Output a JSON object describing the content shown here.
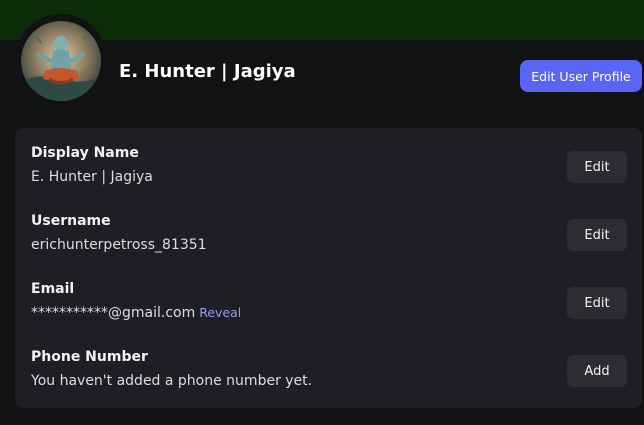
{
  "profile": {
    "display_title": "E. Hunter | Jagiya",
    "edit_profile_label": "Edit User Profile"
  },
  "colors": {
    "banner": "#0a2c06",
    "accent": "#5865f2",
    "card": "#1e1f22",
    "link": "#949cf7"
  },
  "fields": [
    {
      "label": "Display Name",
      "value": "E. Hunter | Jagiya",
      "button": "Edit"
    },
    {
      "label": "Username",
      "value": "erichunterpetross_81351",
      "button": "Edit"
    },
    {
      "label": "Email",
      "value": "***********@gmail.com",
      "link": "Reveal",
      "button": "Edit"
    },
    {
      "label": "Phone Number",
      "value": "You haven't added a phone number yet.",
      "button": "Add"
    }
  ],
  "avatar_icon": "avatar-meditating-figure"
}
